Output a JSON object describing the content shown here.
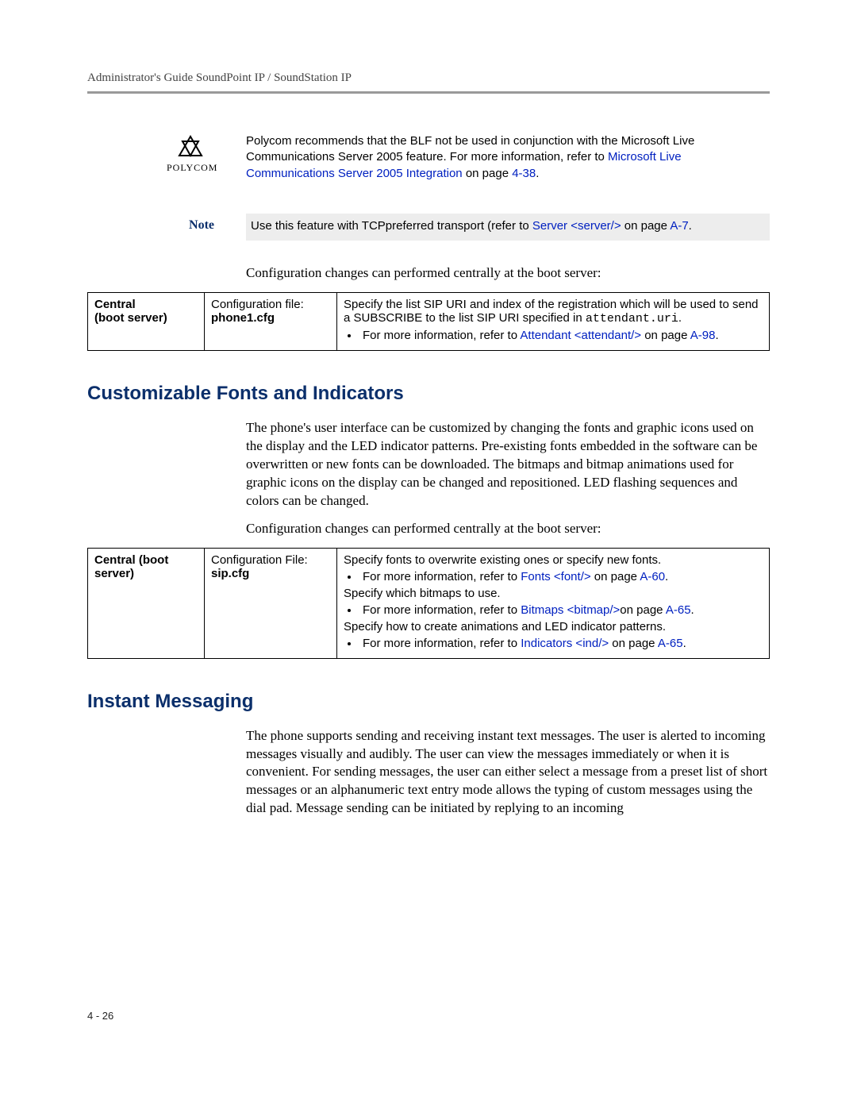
{
  "header": "Administrator's Guide SoundPoint IP / SoundStation IP",
  "logo": {
    "word": "POLYCOM"
  },
  "reco": {
    "pre": "Polycom recommends that the BLF not be used in conjunction with the Microsoft Live Communications Server 2005 feature. For more information, refer to ",
    "link": "Microsoft Live Communications Server 2005 Integration",
    "mid": " on page ",
    "page": "4-38",
    "end": "."
  },
  "note_label": "Note",
  "note": {
    "pre": "Use this feature with TCPpreferred transport (refer to ",
    "link": "Server <server/>",
    "mid": " on page ",
    "page": "A-7",
    "end": "."
  },
  "p1": "Configuration changes can performed centrally at the boot server:",
  "table1": {
    "c1a": "Central",
    "c1b": "(boot server)",
    "c2a": "Configuration file:",
    "c2b": "phone1.cfg",
    "c3a": "Specify the list SIP URI and index of the registration which will be used to send a SUBSCRIBE to the list SIP URI specified in ",
    "c3mono": "attendant.uri",
    "c3dot": ".",
    "b1pre": "For more information, refer to ",
    "b1link": "Attendant <attendant/>",
    "b1mid": " on page ",
    "b1page": "A-98",
    "b1end": "."
  },
  "h2a": "Customizable Fonts and Indicators",
  "p2": "The phone's user interface can be customized by changing the fonts and graphic icons used on the display and the LED indicator patterns. Pre-existing fonts embedded in the software can be overwritten or new fonts can be downloaded. The bitmaps and bitmap animations used for graphic icons on the display can be changed and repositioned. LED flashing sequences and colors can be changed.",
  "p3": "Configuration changes can performed centrally at the boot server:",
  "table2": {
    "c1a": "Central (boot server)",
    "c2a": "Configuration File:",
    "c2b": "sip.cfg",
    "line1": "Specify fonts to overwrite existing ones or specify new fonts.",
    "b1pre": "For more information, refer to ",
    "b1link": "Fonts <font/>",
    "b1mid": " on page ",
    "b1page": "A-60",
    "b1end": ".",
    "line2": "Specify which bitmaps to use.",
    "b2pre": "For more information, refer to ",
    "b2link": "Bitmaps <bitmap/>",
    "b2mid": "on page ",
    "b2page": "A-65",
    "b2end": ".",
    "line3": "Specify how to create animations and LED indicator patterns.",
    "b3pre": "For more information, refer to ",
    "b3link": "Indicators <ind/>",
    "b3mid": " on page ",
    "b3page": "A-65",
    "b3end": "."
  },
  "h2b": "Instant Messaging",
  "p4": "The phone supports sending and receiving instant text messages. The user is alerted to incoming messages visually and audibly. The user can view the messages immediately or when it is convenient. For sending messages, the user can either select a message from a preset list of short messages or an alphanumeric text entry mode allows the typing of custom messages using the dial pad. Message sending can be initiated by replying to an incoming",
  "footer": "4 - 26"
}
